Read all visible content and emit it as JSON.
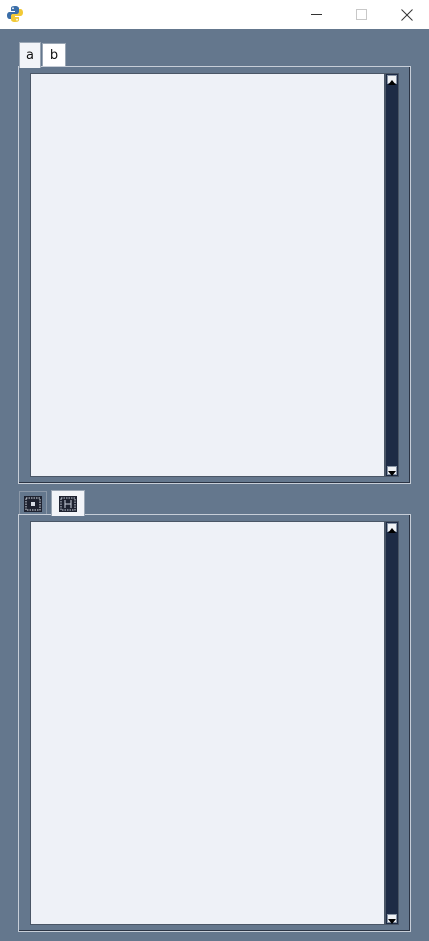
{
  "window": {
    "icons": {
      "app": "python-logo-icon",
      "minimize": "minimize-icon",
      "maximize": "maximize-icon",
      "close": "close-icon"
    }
  },
  "top_notebook": {
    "tabs": [
      {
        "label": "a",
        "selected": true
      },
      {
        "label": "b",
        "selected": false
      }
    ],
    "text_content": ""
  },
  "bottom_notebook": {
    "tabs": [
      {
        "icon": "chip-frame-icon",
        "selected": false
      },
      {
        "icon": "circuit-board-icon",
        "selected": true
      }
    ],
    "text_content": ""
  },
  "colors": {
    "background": "#64778d",
    "text_area": "#eef1f7",
    "scrollbar_trough": "#1d2b45"
  }
}
